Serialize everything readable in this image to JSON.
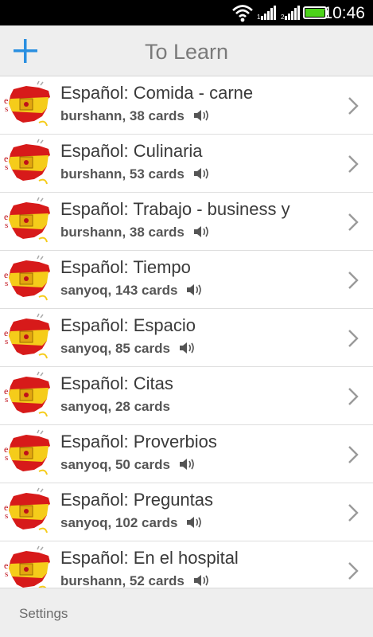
{
  "status_bar": {
    "time": "10:46",
    "icons": [
      "wifi-icon",
      "signal-icon",
      "signal-2g-icon",
      "battery-icon"
    ],
    "battery_color": "#4cd31a"
  },
  "action_bar": {
    "title": "To Learn",
    "add_icon": "plus-icon",
    "accent": "#2a8fe0"
  },
  "decks": [
    {
      "title": "Español: Comida - carne",
      "subtitle": "burshann, 38 cards",
      "audio": true
    },
    {
      "title": "Español: Culinaria",
      "subtitle": "burshann, 53 cards",
      "audio": true
    },
    {
      "title": "Español: Trabajo - business y",
      "subtitle": "burshann, 38 cards",
      "audio": true
    },
    {
      "title": "Español: Tiempo",
      "subtitle": "sanyoq, 143 cards",
      "audio": true
    },
    {
      "title": "Español: Espacio",
      "subtitle": "sanyoq, 85 cards",
      "audio": true
    },
    {
      "title": "Español: Citas",
      "subtitle": "sanyoq, 28 cards",
      "audio": false
    },
    {
      "title": "Español: Proverbios",
      "subtitle": "sanyoq, 50 cards",
      "audio": true
    },
    {
      "title": "Español: Preguntas",
      "subtitle": "sanyoq, 102 cards",
      "audio": true
    },
    {
      "title": "Español: En el hospital",
      "subtitle": "burshann, 52 cards",
      "audio": true
    }
  ],
  "bottom_bar": {
    "settings_label": "Settings"
  }
}
